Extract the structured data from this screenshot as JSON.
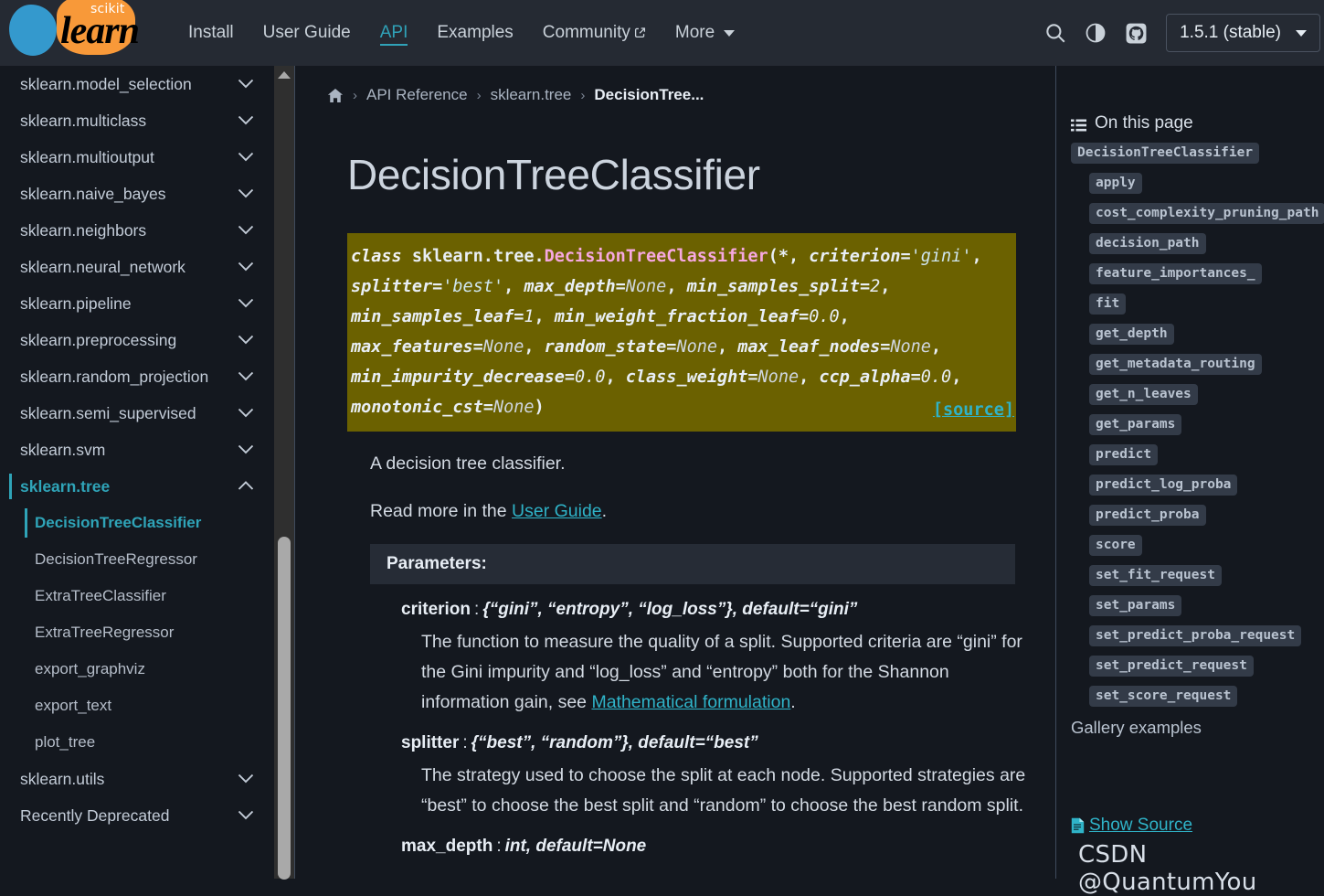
{
  "header": {
    "logo": {
      "top_text": "scikit",
      "bottom_text": "learn"
    },
    "nav": [
      {
        "label": "Install",
        "active": false,
        "external": false
      },
      {
        "label": "User Guide",
        "active": false,
        "external": false
      },
      {
        "label": "API",
        "active": true,
        "external": false
      },
      {
        "label": "Examples",
        "active": false,
        "external": false
      },
      {
        "label": "Community",
        "active": false,
        "external": true
      },
      {
        "label": "More",
        "active": false,
        "external": false,
        "dropdown": true
      }
    ],
    "icons": [
      "search-icon",
      "theme-toggle-icon",
      "github-icon"
    ],
    "version_selector": "1.5.1 (stable)"
  },
  "sidebar": {
    "modules": [
      {
        "label": "sklearn.model_selection",
        "expanded": false
      },
      {
        "label": "sklearn.multiclass",
        "expanded": false
      },
      {
        "label": "sklearn.multioutput",
        "expanded": false
      },
      {
        "label": "sklearn.naive_bayes",
        "expanded": false
      },
      {
        "label": "sklearn.neighbors",
        "expanded": false
      },
      {
        "label": "sklearn.neural_network",
        "expanded": false
      },
      {
        "label": "sklearn.pipeline",
        "expanded": false
      },
      {
        "label": "sklearn.preprocessing",
        "expanded": false
      },
      {
        "label": "sklearn.random_projection",
        "expanded": false
      },
      {
        "label": "sklearn.semi_supervised",
        "expanded": false
      },
      {
        "label": "sklearn.svm",
        "expanded": false
      },
      {
        "label": "sklearn.tree",
        "expanded": true,
        "active": true
      }
    ],
    "tree_children": [
      {
        "label": "DecisionTreeClassifier",
        "active": true
      },
      {
        "label": "DecisionTreeRegressor",
        "active": false
      },
      {
        "label": "ExtraTreeClassifier",
        "active": false
      },
      {
        "label": "ExtraTreeRegressor",
        "active": false
      },
      {
        "label": "export_graphviz",
        "active": false
      },
      {
        "label": "export_text",
        "active": false
      },
      {
        "label": "plot_tree",
        "active": false
      }
    ],
    "modules_after": [
      {
        "label": "sklearn.utils",
        "expanded": false
      },
      {
        "label": "Recently Deprecated",
        "expanded": false
      }
    ],
    "chevron_down": "⌄",
    "chevron_up": "⌃"
  },
  "breadcrumb": {
    "home": "home-icon",
    "items": [
      "API Reference",
      "sklearn.tree",
      "DecisionTree..."
    ],
    "separator": "›"
  },
  "main": {
    "title": "DecisionTreeClassifier",
    "signature": {
      "keyword": "class",
      "qualified_prefix": "sklearn.tree.",
      "class_name": "DecisionTreeClassifier",
      "open_paren": "(",
      "close_paren": ")",
      "star": "*",
      "params": [
        {
          "name": "criterion",
          "value": "'gini'",
          "kind": "str"
        },
        {
          "name": "splitter",
          "value": "'best'",
          "kind": "str"
        },
        {
          "name": "max_depth",
          "value": "None",
          "kind": "none"
        },
        {
          "name": "min_samples_split",
          "value": "2",
          "kind": "num"
        },
        {
          "name": "min_samples_leaf",
          "value": "1",
          "kind": "num"
        },
        {
          "name": "min_weight_fraction_leaf",
          "value": "0.0",
          "kind": "num"
        },
        {
          "name": "max_features",
          "value": "None",
          "kind": "none"
        },
        {
          "name": "random_state",
          "value": "None",
          "kind": "none"
        },
        {
          "name": "max_leaf_nodes",
          "value": "None",
          "kind": "none"
        },
        {
          "name": "min_impurity_decrease",
          "value": "0.0",
          "kind": "num"
        },
        {
          "name": "class_weight",
          "value": "None",
          "kind": "none"
        },
        {
          "name": "ccp_alpha",
          "value": "0.0",
          "kind": "num"
        },
        {
          "name": "monotonic_cst",
          "value": "None",
          "kind": "none"
        }
      ],
      "source_link": "[source]"
    },
    "summary": "A decision tree classifier.",
    "read_more_prefix": "Read more in the ",
    "read_more_link": "User Guide",
    "read_more_suffix": ".",
    "params_header": "Parameters:",
    "parameters": [
      {
        "name": "criterion",
        "colon": ":",
        "type": "{“gini”, “entropy”, “log_loss”}, default=“gini”",
        "desc_before_link": "The function to measure the quality of a split. Supported criteria are “gini” for the Gini impurity and “log_loss” and “entropy” both for the Shannon information gain, see ",
        "desc_link": "Mathematical formulation",
        "desc_after_link": "."
      },
      {
        "name": "splitter",
        "colon": ":",
        "type": "{“best”, “random”}, default=“best”",
        "desc_before_link": "The strategy used to choose the split at each node. Supported strategies are “best” to choose the best split and “random” to choose the best random split.",
        "desc_link": "",
        "desc_after_link": ""
      },
      {
        "name": "max_depth",
        "colon": ":",
        "type": "int, default=None",
        "desc_before_link": "",
        "desc_link": "",
        "desc_after_link": ""
      }
    ]
  },
  "rightbar": {
    "title": "On this page",
    "entries": [
      {
        "label": "DecisionTreeClassifier",
        "level": 1,
        "chip": true
      },
      {
        "label": "apply",
        "level": 2,
        "chip": true
      },
      {
        "label": "cost_complexity_pruning_path",
        "level": 2,
        "chip": true
      },
      {
        "label": "decision_path",
        "level": 2,
        "chip": true
      },
      {
        "label": "feature_importances_",
        "level": 2,
        "chip": true
      },
      {
        "label": "fit",
        "level": 2,
        "chip": true
      },
      {
        "label": "get_depth",
        "level": 2,
        "chip": true
      },
      {
        "label": "get_metadata_routing",
        "level": 2,
        "chip": true
      },
      {
        "label": "get_n_leaves",
        "level": 2,
        "chip": true
      },
      {
        "label": "get_params",
        "level": 2,
        "chip": true
      },
      {
        "label": "predict",
        "level": 2,
        "chip": true
      },
      {
        "label": "predict_log_proba",
        "level": 2,
        "chip": true
      },
      {
        "label": "predict_proba",
        "level": 2,
        "chip": true
      },
      {
        "label": "score",
        "level": 2,
        "chip": true
      },
      {
        "label": "set_fit_request",
        "level": 2,
        "chip": true
      },
      {
        "label": "set_params",
        "level": 2,
        "chip": true
      },
      {
        "label": "set_predict_proba_request",
        "level": 2,
        "chip": true
      },
      {
        "label": "set_predict_request",
        "level": 2,
        "chip": true
      },
      {
        "label": "set_score_request",
        "level": 2,
        "chip": true
      },
      {
        "label": "Gallery examples",
        "level": 1,
        "chip": false
      }
    ],
    "show_source": "Show Source"
  },
  "watermark": "CSDN @QuantumYou",
  "colors": {
    "header_bg": "#252a33",
    "page_bg": "#14181f",
    "accent": "#2fa4b8",
    "link": "#2fb3c8",
    "signature_bg": "#6b6100",
    "chip_bg": "#333b48",
    "logo_blue": "#3499cd",
    "logo_orange": "#f89939"
  }
}
